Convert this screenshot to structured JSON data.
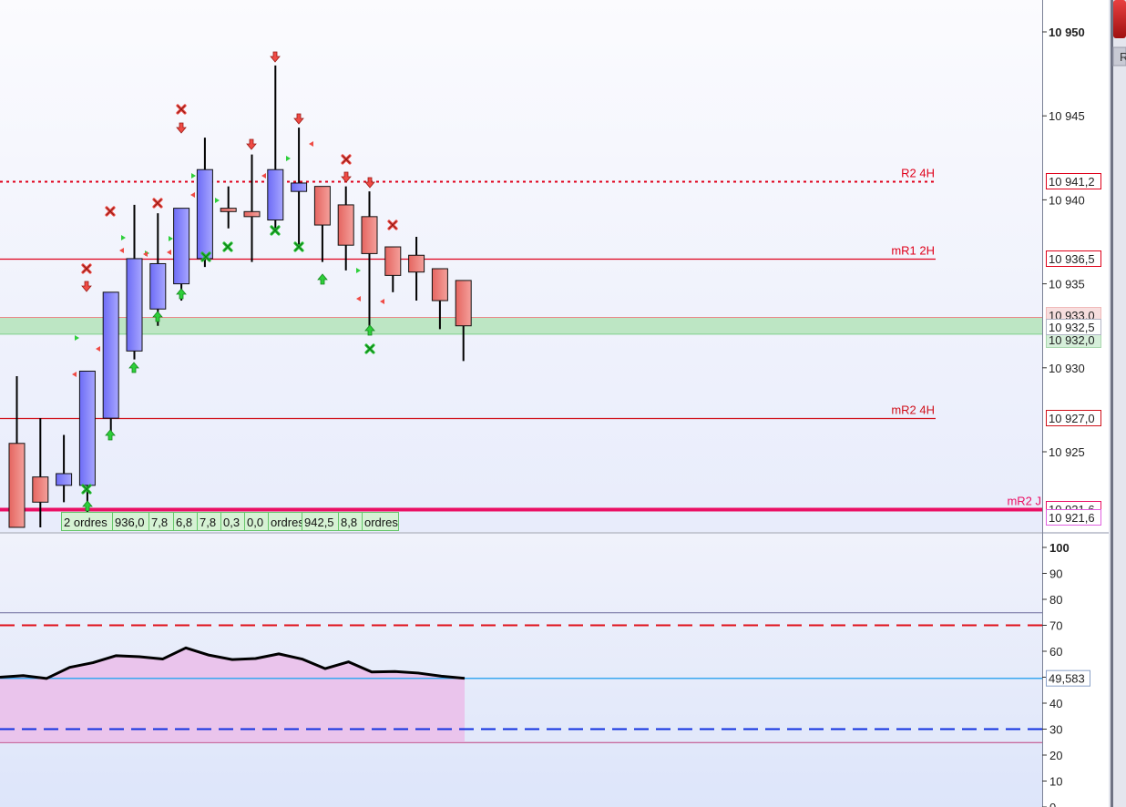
{
  "chart_data": [
    {
      "type": "candlestick",
      "title": "",
      "y_axis": {
        "range": [
          10920.6,
          10951.8
        ],
        "ticks": [
          "10 950",
          "10 945",
          "10 940",
          "10 935",
          "10 930",
          "10 925"
        ],
        "tick_values": [
          10950,
          10945,
          10940,
          10935,
          10930,
          10925
        ],
        "bold_tick": "10 950"
      },
      "candles": [
        {
          "o": 10925.5,
          "h": 10929.5,
          "l": 10921,
          "c": 10920.5,
          "dir": "down"
        },
        {
          "o": 10923.5,
          "h": 10927,
          "l": 10920.5,
          "c": 10922,
          "dir": "down"
        },
        {
          "o": 10923,
          "h": 10926,
          "l": 10922,
          "c": 10923.7,
          "dir": "up"
        },
        {
          "o": 10923,
          "h": 10924.5,
          "l": 10921,
          "c": 10929.8,
          "dir": "up"
        },
        {
          "o": 10927,
          "h": 10931.5,
          "l": 10926,
          "c": 10934.5,
          "dir": "up"
        },
        {
          "o": 10931,
          "h": 10939.7,
          "l": 10930.5,
          "c": 10936.5,
          "dir": "up"
        },
        {
          "o": 10933.5,
          "h": 10939.2,
          "l": 10932.5,
          "c": 10936.2,
          "dir": "up"
        },
        {
          "o": 10935,
          "h": 10937,
          "l": 10934,
          "c": 10939.5,
          "dir": "up"
        },
        {
          "o": 10936.5,
          "h": 10943.7,
          "l": 10936,
          "c": 10941.8,
          "dir": "up"
        },
        {
          "o": 10939.5,
          "h": 10940.8,
          "l": 10938.3,
          "c": 10939.3,
          "dir": "doji"
        },
        {
          "o": 10939.3,
          "h": 10942.7,
          "l": 10936.3,
          "c": 10939.0,
          "dir": "down"
        },
        {
          "o": 10938.8,
          "h": 10948.0,
          "l": 10938.3,
          "c": 10941.8,
          "dir": "up"
        },
        {
          "o": 10941.0,
          "h": 10944.3,
          "l": 10937.3,
          "c": 10940.5,
          "dir": "up"
        },
        {
          "o": 10940.8,
          "h": 10940.8,
          "l": 10936.3,
          "c": 10938.5,
          "dir": "down"
        },
        {
          "o": 10939.7,
          "h": 10940.8,
          "l": 10935.8,
          "c": 10937.3,
          "dir": "down"
        },
        {
          "o": 10939.0,
          "h": 10940.5,
          "l": 10932.5,
          "c": 10936.8,
          "dir": "down"
        },
        {
          "o": 10937.2,
          "h": 10937.2,
          "l": 10934.5,
          "c": 10935.5,
          "dir": "down"
        },
        {
          "o": 10936.7,
          "h": 10937.8,
          "l": 10934.0,
          "c": 10935.7,
          "dir": "down"
        },
        {
          "o": 10935.9,
          "h": 10935.9,
          "l": 10932.3,
          "c": 10934.0,
          "dir": "down"
        },
        {
          "o": 10935.2,
          "h": 10935.2,
          "l": 10930.4,
          "c": 10932.5,
          "dir": "down"
        }
      ],
      "levels": [
        {
          "name": "R2 4H",
          "value": 10941.1,
          "value_label": "10 941,2",
          "style": "dotted",
          "color": "#e0001a"
        },
        {
          "name": "mR1 2H",
          "value": 10936.5,
          "value_label": "10 936,5",
          "style": "solid",
          "color": "#e0001a"
        },
        {
          "name": "mR2 4H",
          "value": 10927.0,
          "value_label": "10 927,0",
          "style": "solid",
          "color": "#d0101a"
        },
        {
          "name": "mR2 J",
          "value": 10921.6,
          "value_label": "10 921,6",
          "style": "thick",
          "color": "#ea1064"
        }
      ],
      "zone": {
        "high": 10933.0,
        "low": 10932.0,
        "high_label": "10 933,0",
        "low_label": "10 932,0"
      },
      "last_price_label": "10 932,5",
      "second_mr2j_label": "10 921,6",
      "order_tags": [
        "2 ordres",
        "936,0",
        "7,8",
        "6,8",
        "7,8",
        "0,3",
        "0,0",
        "ordres",
        "942,5",
        "8,8",
        "ordres"
      ]
    },
    {
      "type": "line",
      "title": "",
      "y_axis": {
        "range": [
          0,
          100
        ],
        "ticks": [
          "100",
          "90",
          "80",
          "70",
          "60",
          "50",
          "40",
          "30",
          "20",
          "10",
          "0"
        ],
        "tick_values": [
          100,
          90,
          80,
          70,
          60,
          50,
          40,
          30,
          20,
          10,
          0
        ],
        "bold_tick": "100"
      },
      "series": [
        {
          "values": [
            50,
            50.6,
            49.5,
            53.8,
            55.6,
            58.3,
            57.9,
            57.0,
            61.3,
            58.5,
            56.8,
            57.2,
            59.0,
            57.0,
            53.3,
            55.9,
            52.0,
            52.2,
            51.6,
            50.4,
            49.583
          ]
        }
      ],
      "fill_band": [
        25,
        75
      ],
      "fill_color": "#eac4ec",
      "levels": [
        {
          "value": 70,
          "style": "dashed",
          "color": "#e0101a"
        },
        {
          "value": 30,
          "style": "dashed",
          "color": "#1030e0"
        },
        {
          "value": 49.583,
          "style": "solid",
          "color": "#38a8f0"
        }
      ],
      "current_value_label": "49,583"
    }
  ],
  "colors": {
    "up_candle": "#8a88ff",
    "down_candle": "#ee7c78",
    "zone_fill": "#bde6c4",
    "tag_fill": "#d6f2d4",
    "tag_border": "#66c66a"
  },
  "top_right_button": {
    "label": "R"
  }
}
